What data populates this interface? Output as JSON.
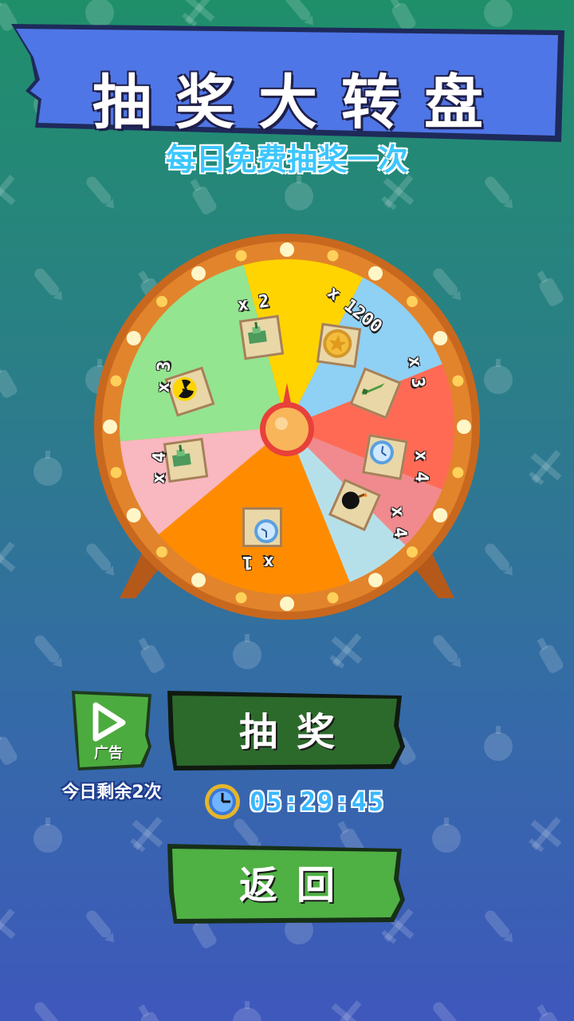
{
  "header": {
    "title": "抽奖大转盘",
    "subtitle": "每日免费抽奖一次"
  },
  "wheel": {
    "segments": [
      {
        "color": "#ffd400",
        "label": "x 2",
        "icon": "tank-icon"
      },
      {
        "color": "#8fd0f5",
        "label": "x 1200",
        "icon": "gold-coin-icon"
      },
      {
        "color": "#ff6a55",
        "label": "x 3",
        "icon": "rocket-icon"
      },
      {
        "color": "#f08a8e",
        "label": "x 4",
        "icon": "clock-icon"
      },
      {
        "color": "#b6e0e9",
        "label": "x 4",
        "icon": "bomb-icon"
      },
      {
        "color": "#ff8c00",
        "label": "x 1",
        "icon": "clock-icon"
      },
      {
        "color": "#f9b7c0",
        "label": "x 4",
        "icon": "tank-icon"
      },
      {
        "color": "#93e58f",
        "label": "x 3",
        "icon": "radiation-icon"
      }
    ]
  },
  "ad": {
    "label": "广告",
    "remaining": "今日剩余2次",
    "icon": "play-icon"
  },
  "buttons": {
    "draw": "抽奖",
    "back": "返回"
  },
  "timer": {
    "value": "05:29:45",
    "icon": "clock-icon"
  }
}
